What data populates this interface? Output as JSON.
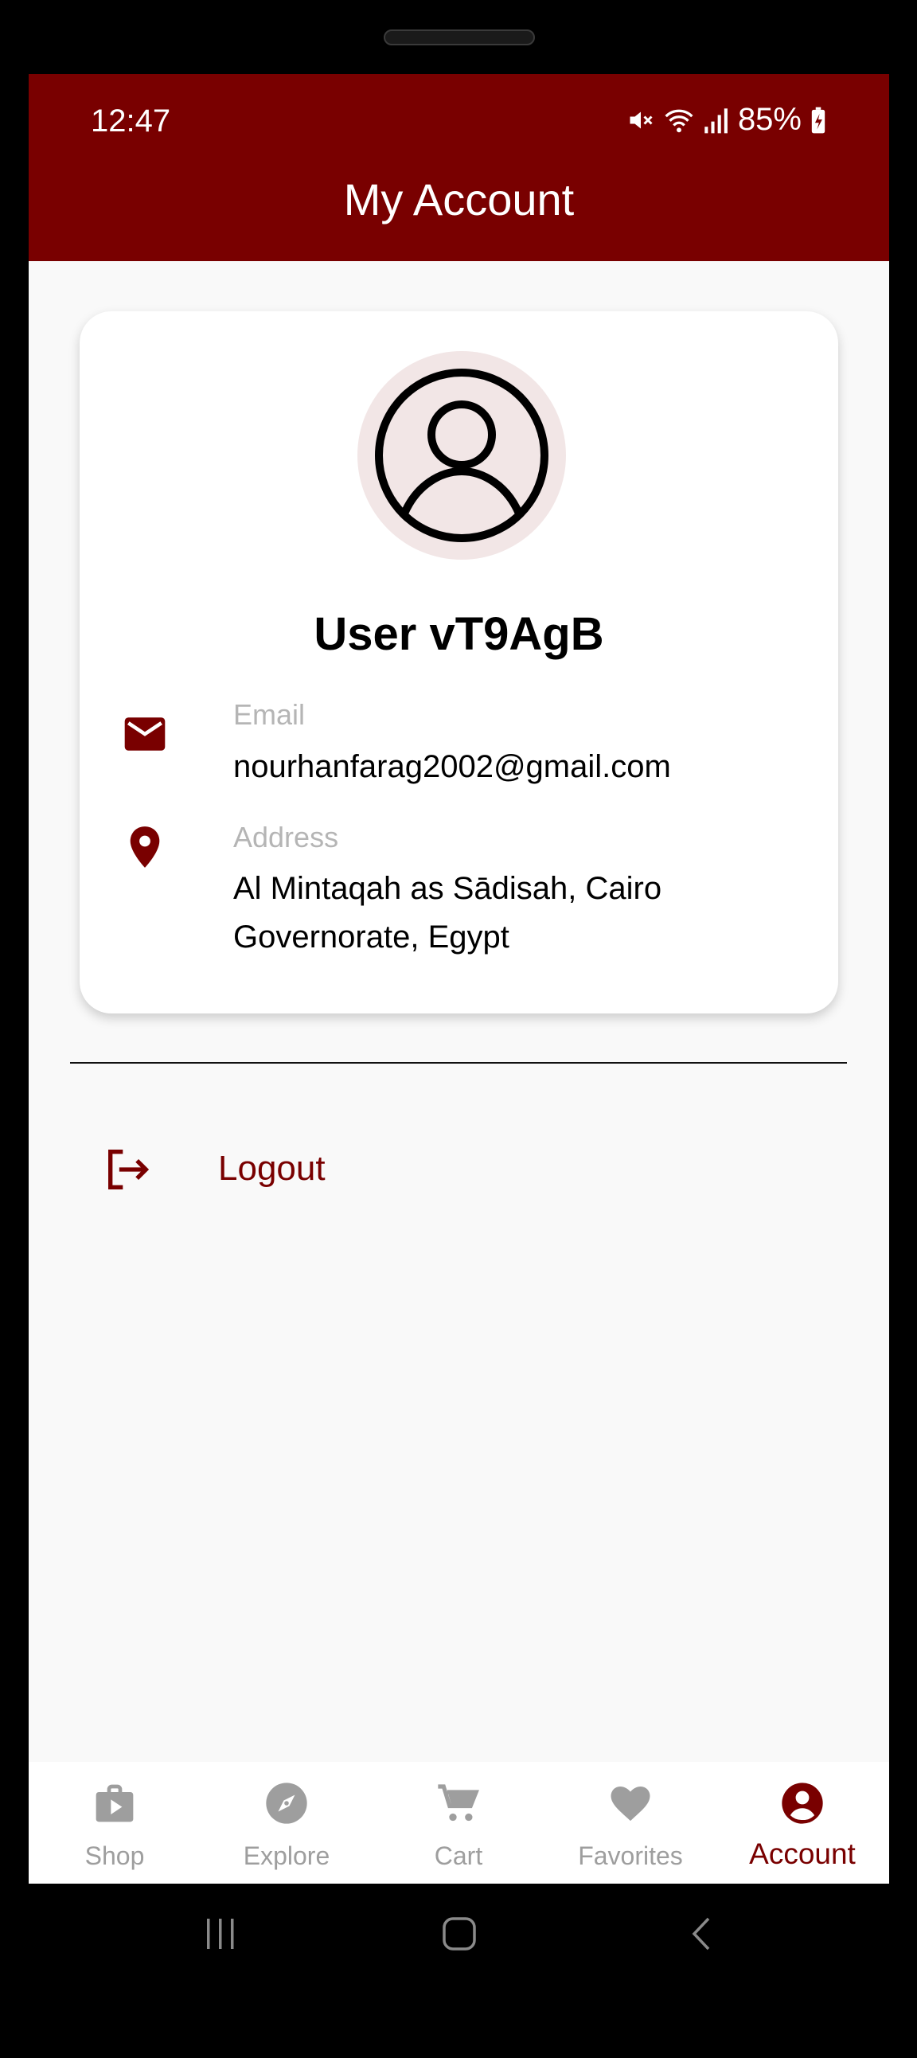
{
  "status_bar": {
    "time": "12:47",
    "battery": "85%",
    "icons": [
      "mute-icon",
      "wifi-icon",
      "signal-icon",
      "battery-charging-icon"
    ]
  },
  "app_bar": {
    "title": "My Account"
  },
  "profile": {
    "avatar_icon": "account-circle-icon",
    "name": "User vT9AgB",
    "email": {
      "icon": "mail-icon",
      "label": "Email",
      "value": "nourhanfarag2002@gmail.com"
    },
    "address": {
      "icon": "location-pin-icon",
      "label": "Address",
      "value": "Al Mintaqah as Sādisah, Cairo Governorate, Egypt"
    }
  },
  "actions": {
    "logout": {
      "icon": "logout-icon",
      "label": "Logout"
    }
  },
  "bottom_nav": {
    "items": [
      {
        "label": "Shop",
        "icon": "shopping-bag-icon",
        "active": false
      },
      {
        "label": "Explore",
        "icon": "compass-icon",
        "active": false
      },
      {
        "label": "Cart",
        "icon": "cart-icon",
        "active": false
      },
      {
        "label": "Favorites",
        "icon": "heart-icon",
        "active": false
      },
      {
        "label": "Account",
        "icon": "account-icon",
        "active": true
      }
    ]
  },
  "system_nav": {
    "buttons": [
      "recents-icon",
      "home-icon",
      "back-icon"
    ]
  },
  "colors": {
    "primary": "#790000",
    "inactive": "#9e9e9e",
    "background": "#f9f9f9",
    "avatar_bg": "#f2e6e6",
    "label_gray": "#b5b5b5"
  }
}
